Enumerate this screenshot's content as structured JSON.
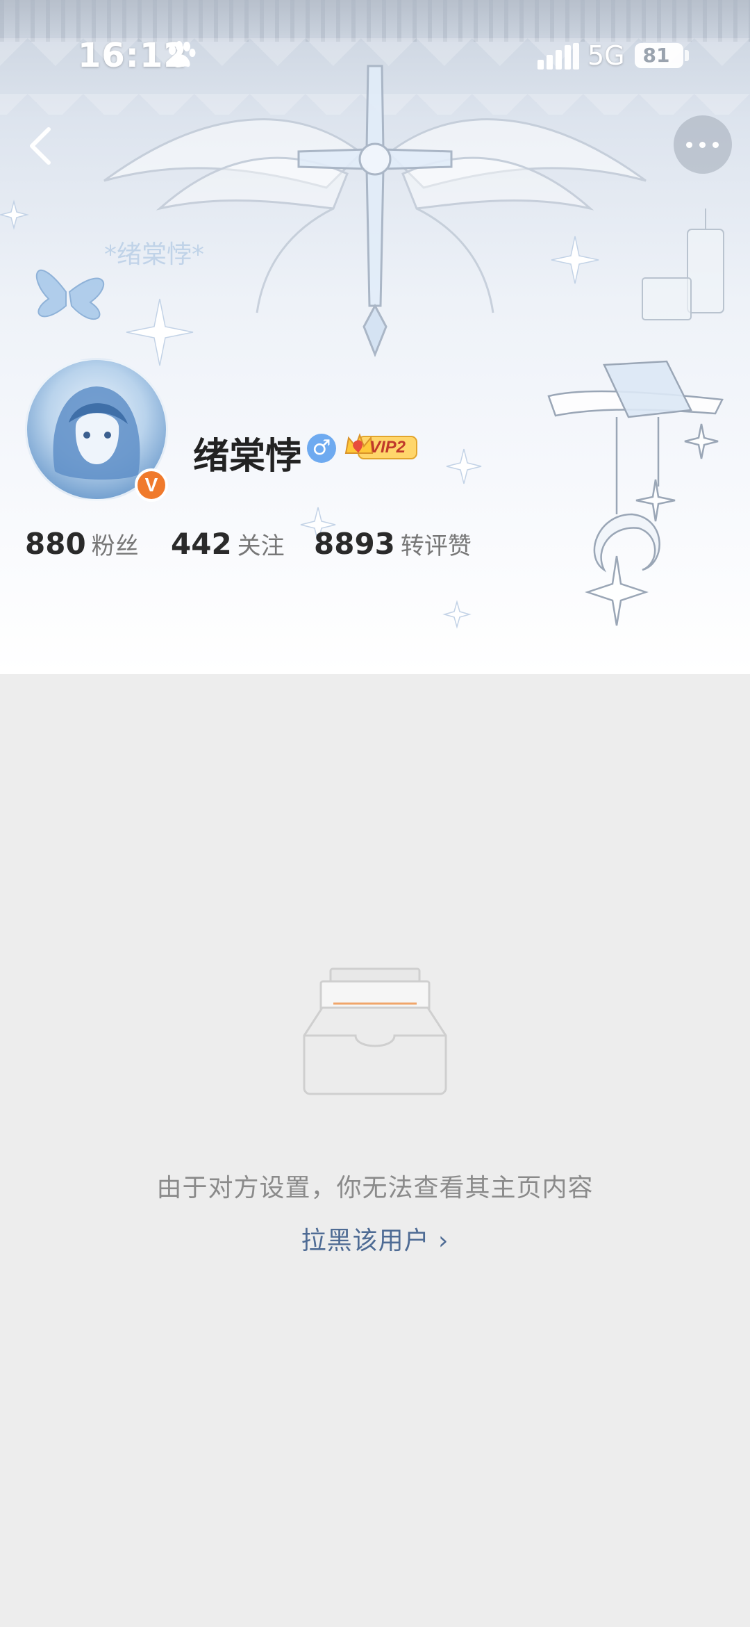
{
  "status_bar": {
    "time": "16:12",
    "network": "5G",
    "battery": "81"
  },
  "profile": {
    "username": "绪棠悖",
    "gender_symbol": "♂",
    "vip_label": "VIP2",
    "verified_mark": "V",
    "stats": [
      {
        "value": "880",
        "label": "粉丝"
      },
      {
        "value": "442",
        "label": "关注"
      },
      {
        "value": "8893",
        "label": "转评赞"
      }
    ]
  },
  "empty_state": {
    "message": "由于对方设置，你无法查看其主页内容",
    "block_link": "拉黑该用户 ›"
  },
  "icons": {
    "back": "chevron-left-icon",
    "more": "more-dots-icon",
    "paw": "paw-icon",
    "signal": "signal-bars-icon",
    "empty": "empty-inbox-icon"
  },
  "colors": {
    "accent_orange": "#f07a2c",
    "link_blue": "#4e6b94",
    "gender_blue": "#6eaaf0",
    "page_bg": "#ededed"
  }
}
